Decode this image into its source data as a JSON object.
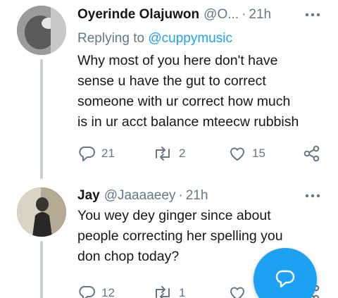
{
  "tweets": [
    {
      "name": "Oyerinde Olajuwon",
      "handle": "@O...",
      "sep": "·",
      "time": "21h",
      "replying_prefix": "Replying to ",
      "replying_handle": "@cuppymusic",
      "lines": [
        "Why most of you here don't have",
        "sense u have the gut to correct",
        "someone with ur correct how much",
        "is in ur acct balance mteecw rubbish"
      ],
      "reply_count": "21",
      "retweet_count": "2",
      "like_count": "15"
    },
    {
      "name": "Jay",
      "handle": "@Jaaaaeey",
      "sep": "·",
      "time": "21h",
      "lines": [
        "You wey dey ginger since about",
        "people correcting her spelling you",
        "don chop today?"
      ],
      "reply_count": "12",
      "retweet_count": "1",
      "like_count": ""
    }
  ],
  "colors": {
    "accent": "#1da1f2",
    "muted": "#657786",
    "text": "#14171a"
  },
  "icons": {
    "more": "more-dots-icon",
    "reply": "reply-bubble-icon",
    "retweet": "retweet-icon",
    "like": "heart-icon",
    "share": "share-icon",
    "compose": "compose-reply-icon"
  }
}
